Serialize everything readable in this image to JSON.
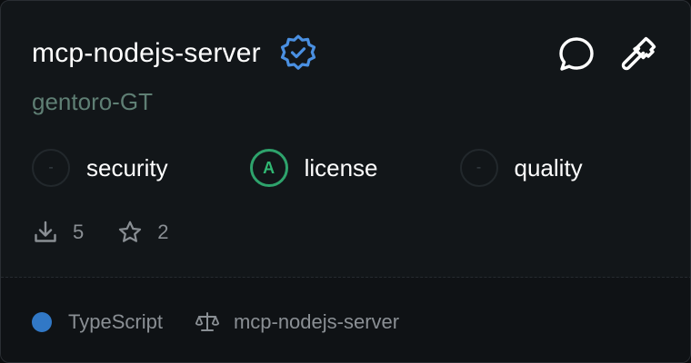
{
  "server": {
    "name": "mcp-nodejs-server",
    "owner": "gentoro-GT",
    "verified": true
  },
  "actions": {
    "chat_icon": "chat-bubble-icon",
    "tools_icon": "hammer-icon"
  },
  "scores": [
    {
      "grade": "-",
      "label": "security"
    },
    {
      "grade": "A",
      "label": "license"
    },
    {
      "grade": "-",
      "label": "quality"
    }
  ],
  "stats": {
    "downloads": "5",
    "stars": "2"
  },
  "footer": {
    "language": "TypeScript",
    "language_color": "#3178c6",
    "license_label": "mcp-nodejs-server"
  },
  "colors": {
    "verified_badge": "#4a90e2",
    "grade_a": "#2ea36c"
  }
}
